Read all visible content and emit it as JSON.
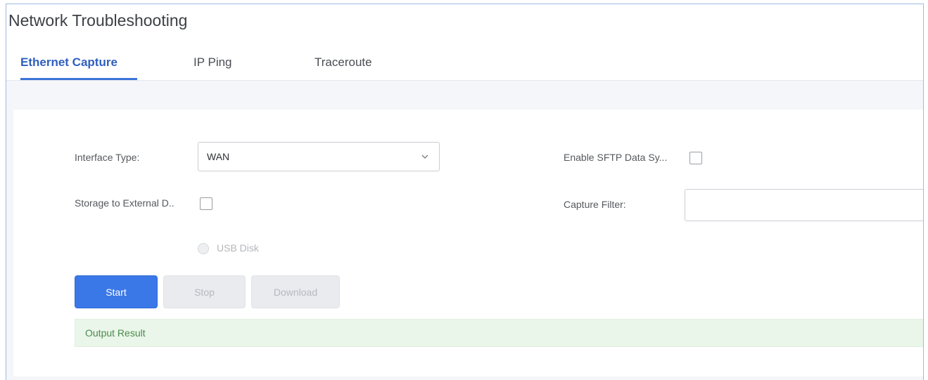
{
  "page": {
    "title": "Network Troubleshooting"
  },
  "tabs": [
    {
      "label": "Ethernet Capture",
      "active": true
    },
    {
      "label": "IP Ping",
      "active": false
    },
    {
      "label": "Traceroute",
      "active": false
    }
  ],
  "form": {
    "interface_type_label": "Interface Type:",
    "interface_type_value": "WAN",
    "storage_label": "Storage to External D..",
    "storage_checked": false,
    "usb_disk_label": "USB Disk",
    "sftp_label": "Enable SFTP Data Sy...",
    "sftp_checked": false,
    "capture_filter_label": "Capture Filter:",
    "capture_filter_value": "",
    "capture_filter_placeholder": ""
  },
  "buttons": {
    "start": "Start",
    "stop": "Stop",
    "download": "Download"
  },
  "output": {
    "label": "Output Result"
  },
  "colors": {
    "accent": "#3b78e7",
    "active_tab": "#2f5fbf",
    "output_bg": "#eaf6ea",
    "output_text": "#4b8b4b"
  },
  "icons": {
    "dropdown": "chevron-down-icon"
  }
}
